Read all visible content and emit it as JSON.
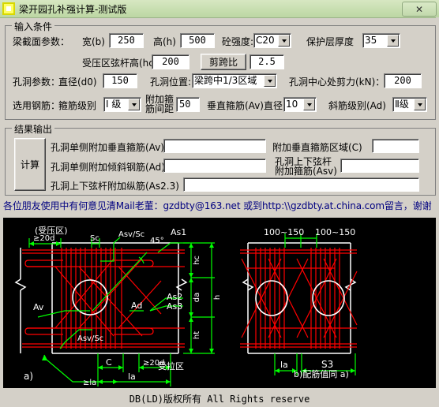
{
  "window": {
    "title": "梁开园孔补强计算-测试版",
    "icon": "app-window-icon",
    "close_label": "✕"
  },
  "input_group": {
    "legend": "输入条件",
    "section_label": "梁截面参数：",
    "width_label": "宽(b)",
    "width_value": "250",
    "height_label": "高(h)",
    "height_value": "500",
    "concrete_label": "砼强度:",
    "concrete_value": "C20",
    "cover_label": "保护层厚度",
    "cover_value": "35",
    "chord_label": "受压区弦杆高(hc)",
    "chord_value": "200",
    "shear_span_button": "剪跨比",
    "shear_span_value": "2.5",
    "hole_param_label": "孔洞参数：",
    "diameter_label": "直径(d0)",
    "diameter_value": "150",
    "position_label": "孔洞位置:",
    "position_value": "梁跨中1/3区域",
    "shear_force_label": "孔洞中心处剪力(kN)：",
    "shear_force_value": "200",
    "rebar_label": "选用钢筋：",
    "stirrup_grade_label": "箍筋级别",
    "stirrup_grade_value": "Ⅰ 级",
    "extra_stirrup_spacing_label": "附加箍\n筋间距",
    "extra_stirrup_spacing_line1": "附加箍",
    "extra_stirrup_spacing_line2": "筋间距",
    "extra_stirrup_spacing_value": "50",
    "vertical_stirrup_label": "垂直箍筋(Av)直径",
    "vertical_stirrup_value": "10",
    "diagonal_grade_label": "斜筋级别(Ad)",
    "diagonal_grade_value": "Ⅱ级"
  },
  "output_group": {
    "legend": "结果输出",
    "calc_button": "计算",
    "row1_label": "孔洞单侧附加垂直箍筋(Av)",
    "row1_value": "",
    "row1b_label": "附加垂直箍筋区域(C)",
    "row1b_value": "",
    "row2_label": "孔洞单侧附加倾斜钢筋(Ad)",
    "row2_value": "",
    "row2b_label_line1": "孔洞上下弦杆",
    "row2b_label_line2": "附加箍筋(Asv)",
    "row2b_value": "",
    "row3_label": "孔洞上下弦杆附加纵筋(As2.3)",
    "row3_value": ""
  },
  "notice": "各位朋友使用中有何意见清Mail老董：gzdbty@163.net 或到http:\\\\gzdbty.at.china.com留言，谢谢",
  "diagram": {
    "labels_left": {
      "compression_zone": "(受压区)",
      "tension_zone": "受拉区",
      "dim_20d_top": "≥20d",
      "dim_sc": "Sc",
      "asv_sc_top": "Asv/Sc",
      "angle": "45°",
      "as1": "As1",
      "av": "Av",
      "ad": "Ad",
      "as2": "As2",
      "as3": "As3",
      "asv_sc_bottom": "Asv/Sc",
      "dim_c": "C",
      "dim_20d_bottom": "≥20d",
      "dim_la_bottom": "la",
      "dim_ge_la": "≥la",
      "view_label": "a)",
      "hc": "hc",
      "da": "da",
      "ht": "ht",
      "h": "h"
    },
    "labels_right": {
      "spacing1": "100~150",
      "spacing2": "100~150",
      "dim_la": "la",
      "dim_s3": "S3",
      "view_label": "b)配筋值同 a)"
    }
  },
  "footer": {
    "text": "DB(LD)版权所有 All Rights reserve"
  },
  "colors": {
    "titlebar": "#c9dfb2",
    "form_bg": "#d4d0c8",
    "notice": "#000080",
    "diagram_bg": "#000000",
    "rebar_red": "#ff0000",
    "dim_green": "#00ff00",
    "outline_white": "#ffffff"
  }
}
